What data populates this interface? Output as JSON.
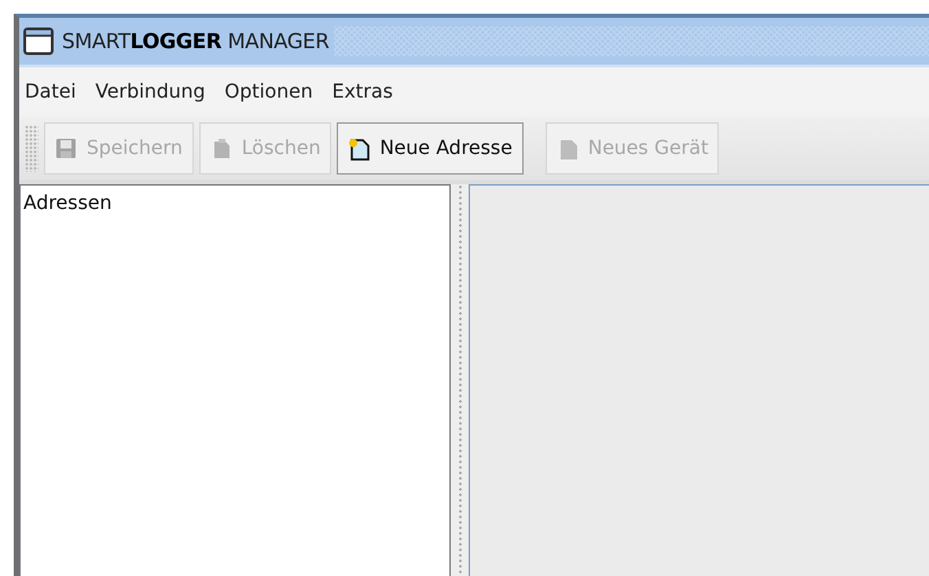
{
  "window": {
    "title": "SMART**LOGGER** MANAGER"
  },
  "menu": [
    "Datei",
    "Verbindung",
    "Optionen",
    "Extras"
  ],
  "toolbar": [
    {
      "label": "Speichern",
      "kind": "save",
      "disabled": true
    },
    {
      "label": "Löschen",
      "kind": "delete",
      "disabled": true
    },
    {
      "label": "Neue Adresse",
      "kind": "newaddress",
      "disabled": false
    },
    {
      "label": "Neues Gerät",
      "kind": "newdevice",
      "disabled": true
    }
  ],
  "tree": {
    "root": "Adressen"
  }
}
